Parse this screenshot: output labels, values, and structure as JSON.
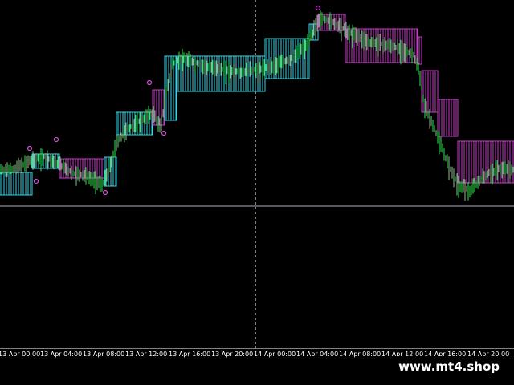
{
  "colors": {
    "background": "#000000",
    "bull_band": "#39d4e6",
    "bear_band": "#c83dc8",
    "candle_up": "#2ee64a",
    "candle_down": "#8fbf8f",
    "signal": "#d24fd8",
    "grid": "#ffffff",
    "axis_text": "#ffffff"
  },
  "time_axis": {
    "labels": [
      "13 Apr 00:00",
      "13 Apr 04:00",
      "13 Apr 08:00",
      "13 Apr 12:00",
      "13 Apr 16:00",
      "13 Apr 20:00",
      "14 Apr 00:00",
      "14 Apr 04:00",
      "14 Apr 08:00",
      "14 Apr 12:00",
      "14 Apr 16:00",
      "14 Apr 20:00"
    ]
  },
  "watermark": {
    "text": "www.mt4.shop"
  }
}
